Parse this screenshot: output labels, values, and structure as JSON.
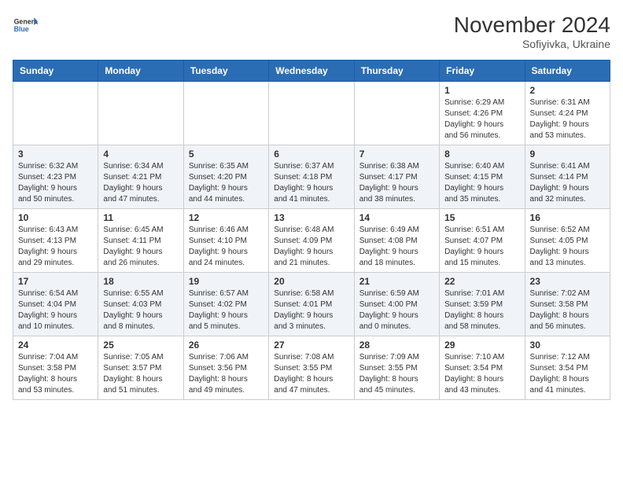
{
  "header": {
    "logo_line1": "General",
    "logo_line2": "Blue",
    "month_year": "November 2024",
    "location": "Sofiyivka, Ukraine"
  },
  "weekdays": [
    "Sunday",
    "Monday",
    "Tuesday",
    "Wednesday",
    "Thursday",
    "Friday",
    "Saturday"
  ],
  "weeks": [
    [
      {
        "day": "",
        "info": ""
      },
      {
        "day": "",
        "info": ""
      },
      {
        "day": "",
        "info": ""
      },
      {
        "day": "",
        "info": ""
      },
      {
        "day": "",
        "info": ""
      },
      {
        "day": "1",
        "info": "Sunrise: 6:29 AM\nSunset: 4:26 PM\nDaylight: 9 hours\nand 56 minutes."
      },
      {
        "day": "2",
        "info": "Sunrise: 6:31 AM\nSunset: 4:24 PM\nDaylight: 9 hours\nand 53 minutes."
      }
    ],
    [
      {
        "day": "3",
        "info": "Sunrise: 6:32 AM\nSunset: 4:23 PM\nDaylight: 9 hours\nand 50 minutes."
      },
      {
        "day": "4",
        "info": "Sunrise: 6:34 AM\nSunset: 4:21 PM\nDaylight: 9 hours\nand 47 minutes."
      },
      {
        "day": "5",
        "info": "Sunrise: 6:35 AM\nSunset: 4:20 PM\nDaylight: 9 hours\nand 44 minutes."
      },
      {
        "day": "6",
        "info": "Sunrise: 6:37 AM\nSunset: 4:18 PM\nDaylight: 9 hours\nand 41 minutes."
      },
      {
        "day": "7",
        "info": "Sunrise: 6:38 AM\nSunset: 4:17 PM\nDaylight: 9 hours\nand 38 minutes."
      },
      {
        "day": "8",
        "info": "Sunrise: 6:40 AM\nSunset: 4:15 PM\nDaylight: 9 hours\nand 35 minutes."
      },
      {
        "day": "9",
        "info": "Sunrise: 6:41 AM\nSunset: 4:14 PM\nDaylight: 9 hours\nand 32 minutes."
      }
    ],
    [
      {
        "day": "10",
        "info": "Sunrise: 6:43 AM\nSunset: 4:13 PM\nDaylight: 9 hours\nand 29 minutes."
      },
      {
        "day": "11",
        "info": "Sunrise: 6:45 AM\nSunset: 4:11 PM\nDaylight: 9 hours\nand 26 minutes."
      },
      {
        "day": "12",
        "info": "Sunrise: 6:46 AM\nSunset: 4:10 PM\nDaylight: 9 hours\nand 24 minutes."
      },
      {
        "day": "13",
        "info": "Sunrise: 6:48 AM\nSunset: 4:09 PM\nDaylight: 9 hours\nand 21 minutes."
      },
      {
        "day": "14",
        "info": "Sunrise: 6:49 AM\nSunset: 4:08 PM\nDaylight: 9 hours\nand 18 minutes."
      },
      {
        "day": "15",
        "info": "Sunrise: 6:51 AM\nSunset: 4:07 PM\nDaylight: 9 hours\nand 15 minutes."
      },
      {
        "day": "16",
        "info": "Sunrise: 6:52 AM\nSunset: 4:05 PM\nDaylight: 9 hours\nand 13 minutes."
      }
    ],
    [
      {
        "day": "17",
        "info": "Sunrise: 6:54 AM\nSunset: 4:04 PM\nDaylight: 9 hours\nand 10 minutes."
      },
      {
        "day": "18",
        "info": "Sunrise: 6:55 AM\nSunset: 4:03 PM\nDaylight: 9 hours\nand 8 minutes."
      },
      {
        "day": "19",
        "info": "Sunrise: 6:57 AM\nSunset: 4:02 PM\nDaylight: 9 hours\nand 5 minutes."
      },
      {
        "day": "20",
        "info": "Sunrise: 6:58 AM\nSunset: 4:01 PM\nDaylight: 9 hours\nand 3 minutes."
      },
      {
        "day": "21",
        "info": "Sunrise: 6:59 AM\nSunset: 4:00 PM\nDaylight: 9 hours\nand 0 minutes."
      },
      {
        "day": "22",
        "info": "Sunrise: 7:01 AM\nSunset: 3:59 PM\nDaylight: 8 hours\nand 58 minutes."
      },
      {
        "day": "23",
        "info": "Sunrise: 7:02 AM\nSunset: 3:58 PM\nDaylight: 8 hours\nand 56 minutes."
      }
    ],
    [
      {
        "day": "24",
        "info": "Sunrise: 7:04 AM\nSunset: 3:58 PM\nDaylight: 8 hours\nand 53 minutes."
      },
      {
        "day": "25",
        "info": "Sunrise: 7:05 AM\nSunset: 3:57 PM\nDaylight: 8 hours\nand 51 minutes."
      },
      {
        "day": "26",
        "info": "Sunrise: 7:06 AM\nSunset: 3:56 PM\nDaylight: 8 hours\nand 49 minutes."
      },
      {
        "day": "27",
        "info": "Sunrise: 7:08 AM\nSunset: 3:55 PM\nDaylight: 8 hours\nand 47 minutes."
      },
      {
        "day": "28",
        "info": "Sunrise: 7:09 AM\nSunset: 3:55 PM\nDaylight: 8 hours\nand 45 minutes."
      },
      {
        "day": "29",
        "info": "Sunrise: 7:10 AM\nSunset: 3:54 PM\nDaylight: 8 hours\nand 43 minutes."
      },
      {
        "day": "30",
        "info": "Sunrise: 7:12 AM\nSunset: 3:54 PM\nDaylight: 8 hours\nand 41 minutes."
      }
    ]
  ]
}
